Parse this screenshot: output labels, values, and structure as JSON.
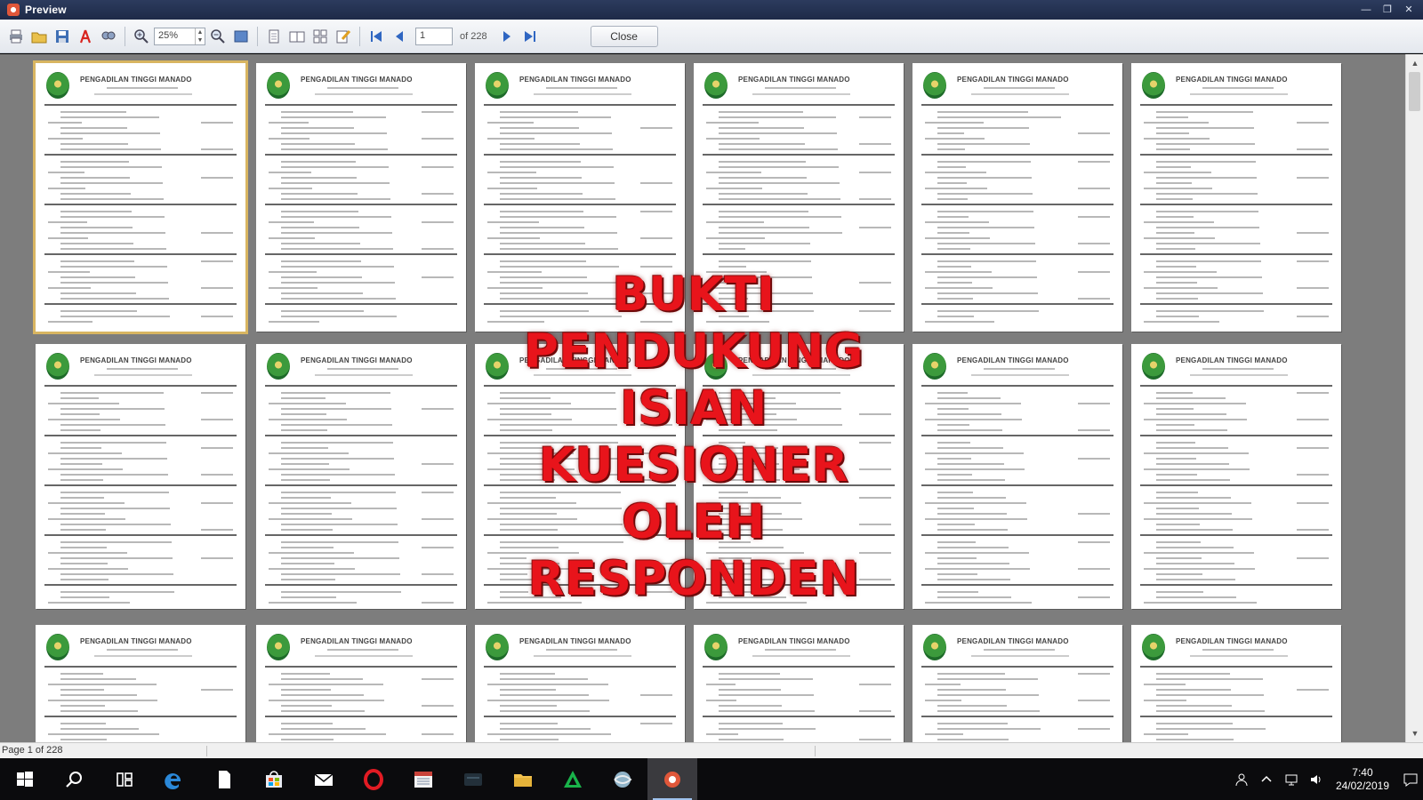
{
  "window": {
    "title": "Preview",
    "controls": [
      "minimize",
      "restore",
      "close"
    ]
  },
  "toolbar": {
    "buttons": [
      "print-icon",
      "open-icon",
      "save-icon",
      "pdf-export-icon",
      "find-icon",
      "zoom-in-icon",
      "zoom-out-icon",
      "fit-page-icon",
      "single-page-icon",
      "two-pages-icon",
      "multi-pages-icon",
      "edit-page-icon",
      "first-page-icon",
      "prev-page-icon",
      "next-page-icon",
      "last-page-icon"
    ],
    "zoom_value": "25%",
    "page_value": "1",
    "of_label": "of 228",
    "close_label": "Close"
  },
  "document": {
    "header_text": "PENGADILAN TINGGI MANADO",
    "selected_page": 1,
    "visible_rows": 3,
    "pages_per_row": 6
  },
  "overlay": {
    "lines": [
      "BUKTI PENDUKUNG",
      "ISIAN KUESIONER",
      "OLEH RESPONDEN"
    ],
    "color": "#e8141b"
  },
  "status": {
    "text": "Page 1 of 228"
  },
  "taskbar": {
    "apps": [
      "windows-start-icon",
      "search-icon",
      "task-view-icon",
      "edge-icon",
      "file-icon",
      "store-icon",
      "mail-icon",
      "opera-icon",
      "calendar-app-icon",
      "terminal-icon",
      "file-explorer-icon",
      "green-triangle-app-icon",
      "globe-app-icon",
      "preview-app-icon"
    ],
    "clock_time": "7:40",
    "clock_date": "24/02/2019"
  }
}
